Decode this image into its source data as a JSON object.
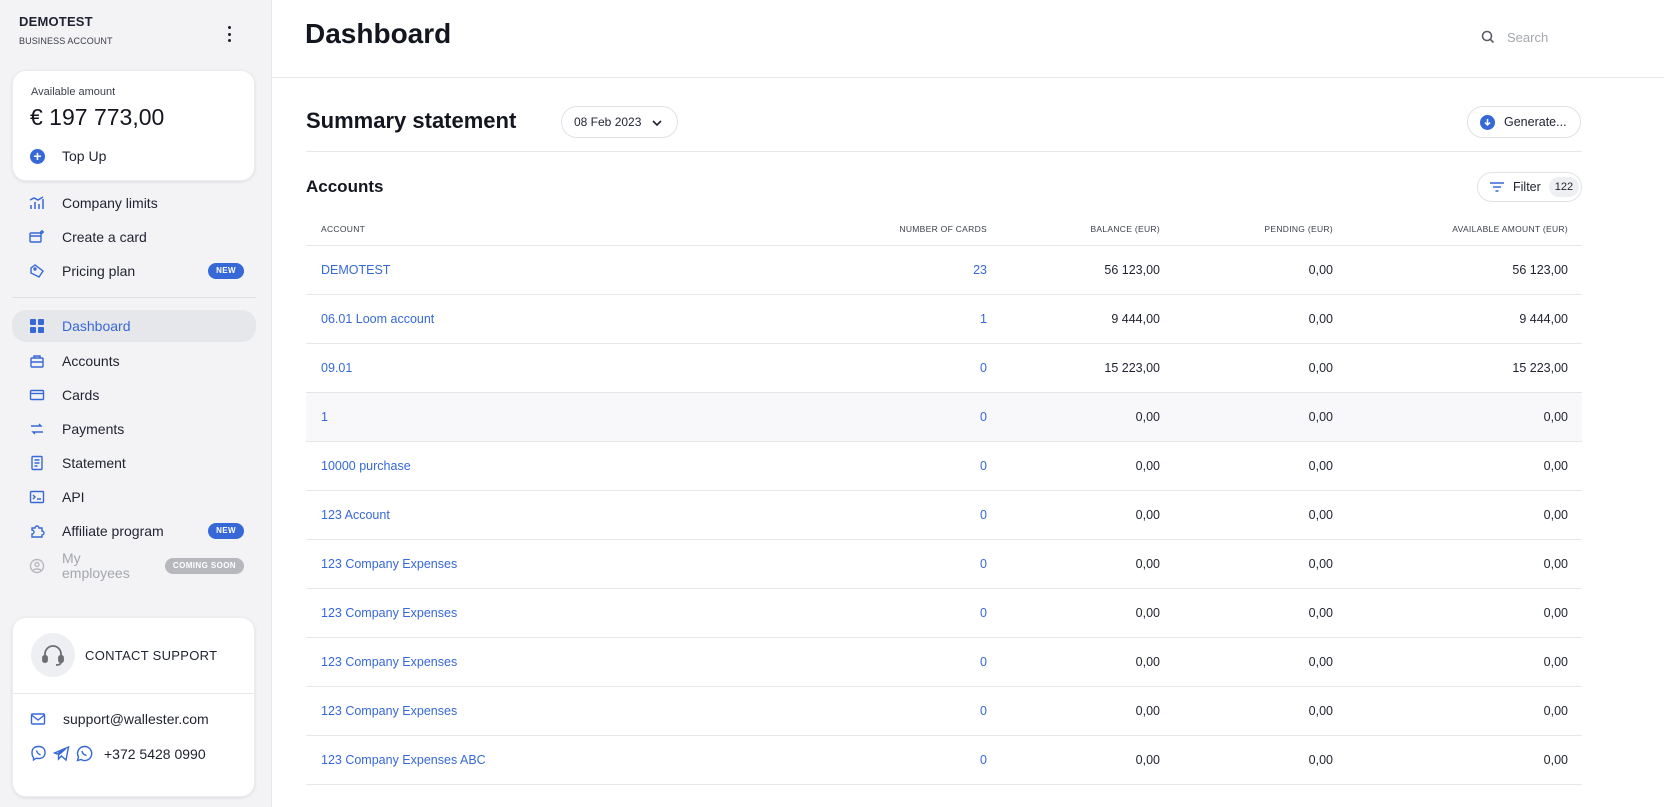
{
  "org": {
    "name": "DEMOTEST",
    "type": "BUSINESS ACCOUNT"
  },
  "balance": {
    "label": "Available amount",
    "value": "€ 197 773,00",
    "topup_label": "Top Up"
  },
  "quick_links": [
    {
      "label": "Company limits",
      "icon": "bar-chart-icon"
    },
    {
      "label": "Create a card",
      "icon": "card-plus-icon"
    },
    {
      "label": "Pricing plan",
      "icon": "tag-icon",
      "badge": "NEW"
    }
  ],
  "nav": [
    {
      "label": "Dashboard",
      "icon": "grid-icon",
      "active": true
    },
    {
      "label": "Accounts",
      "icon": "briefcase-icon"
    },
    {
      "label": "Cards",
      "icon": "credit-card-icon"
    },
    {
      "label": "Payments",
      "icon": "transfer-icon"
    },
    {
      "label": "Statement",
      "icon": "document-icon"
    },
    {
      "label": "API",
      "icon": "terminal-icon"
    },
    {
      "label": "Affiliate program",
      "icon": "puzzle-icon",
      "badge": "NEW"
    },
    {
      "label": "My employees",
      "icon": "user-circle-icon",
      "badge": "COMING SOON",
      "disabled": true
    }
  ],
  "support": {
    "title": "CONTACT SUPPORT",
    "email": "support@wallester.com",
    "phone": "+372 5428 0990"
  },
  "header": {
    "title": "Dashboard",
    "search_placeholder": "Search"
  },
  "summary": {
    "title": "Summary statement",
    "date": "08 Feb 2023",
    "generate_label": "Generate..."
  },
  "accounts": {
    "title": "Accounts",
    "filter_label": "Filter",
    "filter_count": "122",
    "columns": [
      "ACCOUNT",
      "NUMBER OF CARDS",
      "BALANCE (EUR)",
      "PENDING (EUR)",
      "AVAILABLE AMOUNT (EUR)"
    ],
    "rows": [
      {
        "name": "DEMOTEST",
        "cards": "23",
        "balance": "56 123,00",
        "pending": "0,00",
        "available": "56 123,00"
      },
      {
        "name": "06.01 Loom account",
        "cards": "1",
        "balance": "9 444,00",
        "pending": "0,00",
        "available": "9 444,00"
      },
      {
        "name": "09.01",
        "cards": "0",
        "balance": "15 223,00",
        "pending": "0,00",
        "available": "15 223,00"
      },
      {
        "name": "1",
        "cards": "0",
        "balance": "0,00",
        "pending": "0,00",
        "available": "0,00"
      },
      {
        "name": "10000 purchase",
        "cards": "0",
        "balance": "0,00",
        "pending": "0,00",
        "available": "0,00"
      },
      {
        "name": "123 Account",
        "cards": "0",
        "balance": "0,00",
        "pending": "0,00",
        "available": "0,00"
      },
      {
        "name": "123 Company Expenses",
        "cards": "0",
        "balance": "0,00",
        "pending": "0,00",
        "available": "0,00"
      },
      {
        "name": "123 Company Expenses",
        "cards": "0",
        "balance": "0,00",
        "pending": "0,00",
        "available": "0,00"
      },
      {
        "name": "123 Company Expenses",
        "cards": "0",
        "balance": "0,00",
        "pending": "0,00",
        "available": "0,00"
      },
      {
        "name": "123 Company Expenses",
        "cards": "0",
        "balance": "0,00",
        "pending": "0,00",
        "available": "0,00"
      },
      {
        "name": "123 Company Expenses ABC",
        "cards": "0",
        "balance": "0,00",
        "pending": "0,00",
        "available": "0,00"
      }
    ]
  },
  "colors": {
    "accent": "#3768d7",
    "text": "#1f2230",
    "sidebar_bg": "#f3f3f5",
    "badge_soon": "#b6b8bd"
  }
}
